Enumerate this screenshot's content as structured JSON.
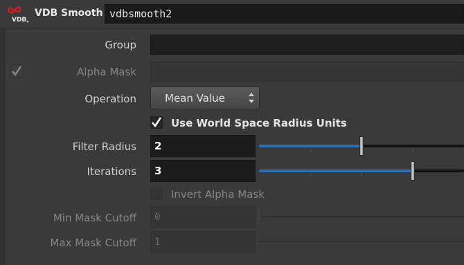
{
  "node": {
    "type_label": "VDB Smooth",
    "icon_text": "VDB",
    "name": "vdbsmooth2"
  },
  "params": {
    "group": {
      "label": "Group",
      "value": ""
    },
    "alpha_mask": {
      "label": "Alpha Mask",
      "value": "",
      "enabled": false
    },
    "operation": {
      "label": "Operation",
      "value": "Mean Value"
    },
    "world_space": {
      "label": "Use World Space Radius Units",
      "checked": true
    },
    "filter_radius": {
      "label": "Filter Radius",
      "value": "2",
      "slider_fraction": 0.5
    },
    "iterations": {
      "label": "Iterations",
      "value": "3",
      "slider_fraction": 0.75
    },
    "invert_alpha": {
      "label": "Invert Alpha Mask",
      "checked": false,
      "enabled": false
    },
    "min_mask": {
      "label": "Min Mask Cutoff",
      "value": "0",
      "enabled": false
    },
    "max_mask": {
      "label": "Max Mask Cutoff",
      "value": "1",
      "enabled": false
    }
  },
  "colors": {
    "slider_fill": "#2f6fb2",
    "icon_red": "#d21e1e"
  }
}
